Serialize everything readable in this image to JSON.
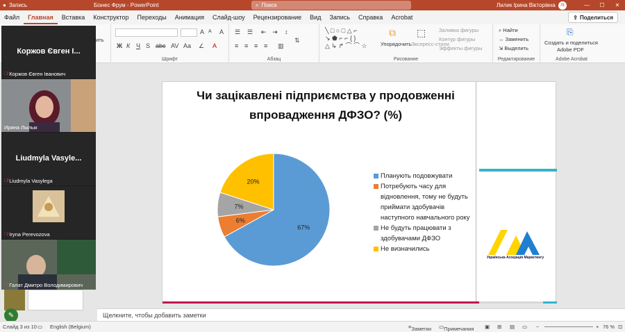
{
  "titlebar": {
    "autosave": "Запись",
    "doc_title": "Бізнес Фрум - PowerPoint",
    "search_placeholder": "Поиск",
    "user_name": "Лилик Ірина Вікторівна",
    "user_initials": "ЛІ"
  },
  "tabs": [
    "Файл",
    "Главная",
    "Вставка",
    "Конструктор",
    "Переходы",
    "Анимация",
    "Слайд-шоу",
    "Рецензирование",
    "Вид",
    "Запись",
    "Справка",
    "Acrobat"
  ],
  "active_tab": "Главная",
  "share_label": "Поделиться",
  "ribbon": {
    "font_group": "Шрифт",
    "paragraph_group": "Абзац",
    "drawing_group": "Рисование",
    "editing_group": "Редактирование",
    "acrobat_group": "Adobe Acrobat",
    "arrange": "Упорядочить",
    "quick_styles": "Экспресс-стили",
    "shape_fill": "Заливка фигуры",
    "shape_outline": "Контур фигуры",
    "shape_effects": "Эффекты фигуры",
    "find": "Найти",
    "replace": "Заменить",
    "select": "Выделить",
    "create_pdf_line1": "Создать и поделиться",
    "create_pdf_line2": "Adobe PDF"
  },
  "participants": [
    {
      "big_name": "Коржов Євген І...",
      "label": "Коржов Євген Іванович",
      "muted": true,
      "video": false
    },
    {
      "big_name": "",
      "label": "Ирина Лылык",
      "muted": false,
      "video": true
    },
    {
      "big_name": "Liudmyla Vasyle...",
      "label": "Liudmyla Vasylega",
      "muted": true,
      "video": false
    },
    {
      "big_name": "",
      "label": "Iryna Perevozova",
      "muted": true,
      "video": false
    },
    {
      "big_name": "",
      "label": "Галат Дмитро Володимирович",
      "muted": true,
      "video": true
    }
  ],
  "slide": {
    "title": "Чи зацікавлені підприємства у продовженні впровадження ДФЗО? (%)",
    "logo_caption": "Українська Асоціація Маркетингу"
  },
  "chart_data": {
    "type": "pie",
    "title": "Чи зацікавлені підприємства у продовженні впровадження ДФЗО? (%)",
    "categories": [
      "Планують подовжувати",
      "Потребують часу для відновлення, тому не будуть приймати здобувачів наступного навчального року",
      "Не будуть працювати з здобувачами ДФЗО",
      "Не визначились"
    ],
    "values": [
      67,
      6,
      7,
      20
    ],
    "labels": [
      "67%",
      "6%",
      "7%",
      "20%"
    ],
    "colors": [
      "#5b9bd5",
      "#ed7d31",
      "#a5a5a5",
      "#ffc000"
    ],
    "legend_position": "right"
  },
  "notes_placeholder": "Щелкните, чтобы добавить заметки",
  "status": {
    "slide_info": "Слайд 3 из 10",
    "language": "English (Belgium)",
    "notes_btn": "Заметки",
    "comments_btn": "Примечания",
    "zoom": "76 %"
  }
}
